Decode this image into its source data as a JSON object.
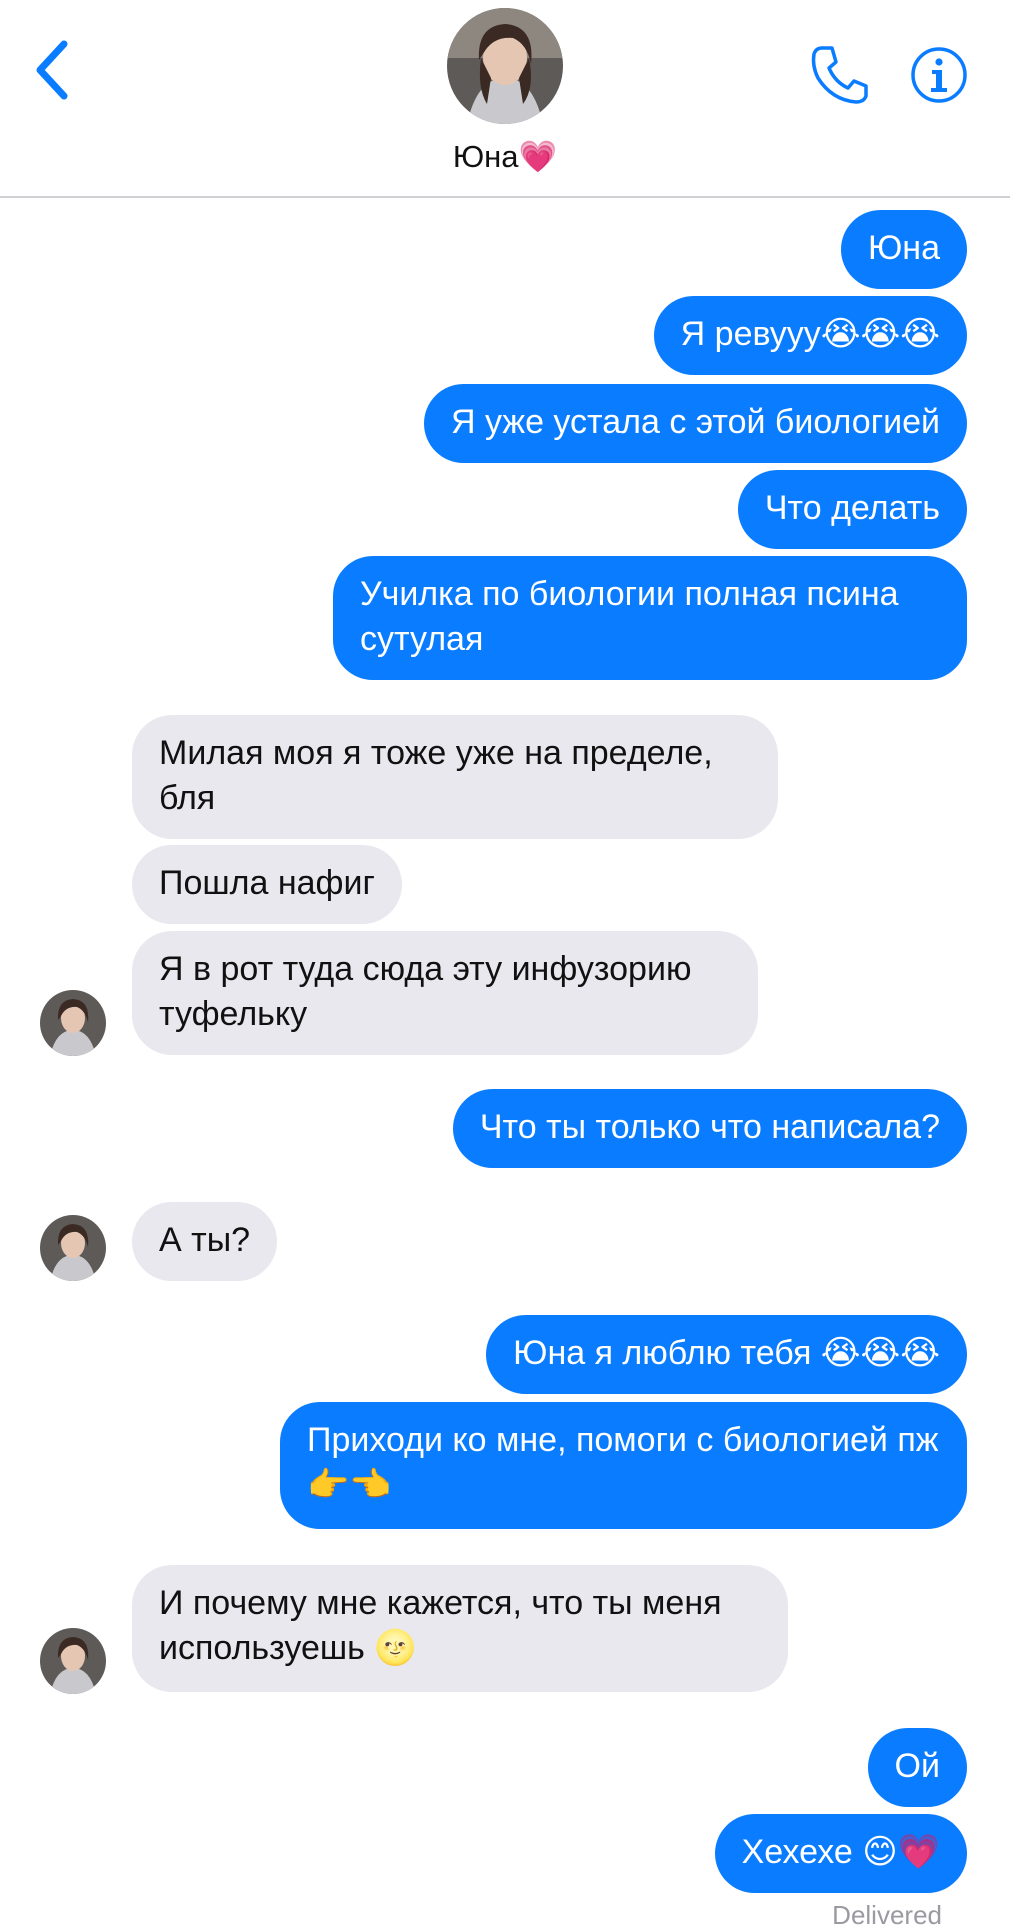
{
  "header": {
    "contact_name": "Юна💗",
    "back_icon": "chevron-left-icon",
    "call_icon": "phone-icon",
    "info_icon": "info-icon",
    "accent": "#0a7cff"
  },
  "colors": {
    "sent_bubble": "#0a7cff",
    "received_bubble": "#e9e8ef",
    "status_text": "#9a9aa0"
  },
  "messages": [
    {
      "dir": "sent",
      "text": "Юна"
    },
    {
      "dir": "sent",
      "text": "Я ревууу😭😭😭"
    },
    {
      "dir": "sent",
      "text": "Я уже устала с этой биологией"
    },
    {
      "dir": "sent",
      "text": "Что делать"
    },
    {
      "dir": "sent",
      "text": "Училка по биологии полная псина сутулая"
    },
    {
      "dir": "received",
      "text": "Милая моя я тоже уже на пределе, бля"
    },
    {
      "dir": "received",
      "text": "Пошла нафиг"
    },
    {
      "dir": "received",
      "text": "Я в рот туда сюда эту инфузорию туфельку"
    },
    {
      "dir": "sent",
      "text": "Что ты только что написала?"
    },
    {
      "dir": "received",
      "text": "А ты?"
    },
    {
      "dir": "sent",
      "text": "Юна я люблю тебя 😭😭😭"
    },
    {
      "dir": "sent",
      "text": "Приходи ко мне, помоги с биологией пж👉👈"
    },
    {
      "dir": "received",
      "text": "И почему мне кажется, что ты меня используешь 🌝"
    },
    {
      "dir": "sent",
      "text": "Ой"
    },
    {
      "dir": "sent",
      "text": "Хехехе 😊💗"
    }
  ],
  "status": "Delivered"
}
